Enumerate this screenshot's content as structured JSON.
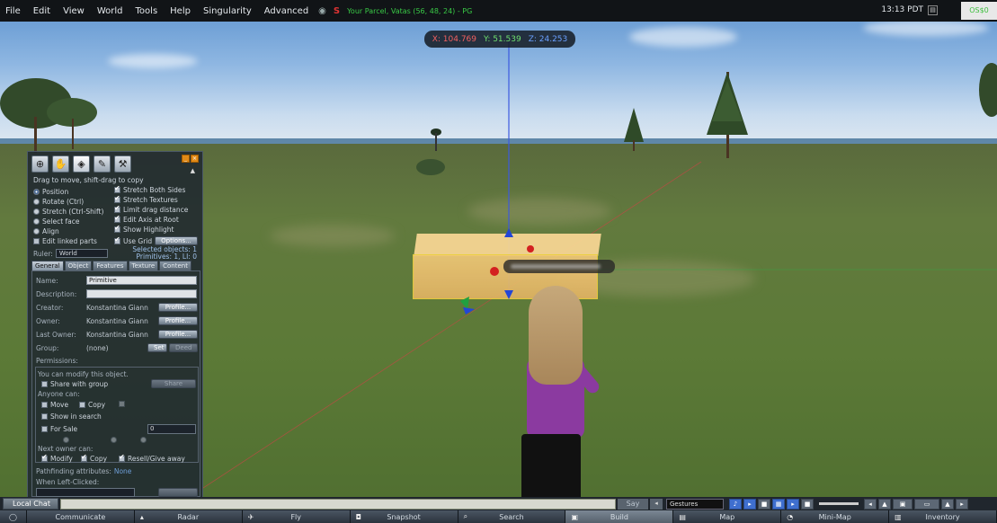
{
  "menubar": {
    "items": [
      "File",
      "Edit",
      "View",
      "World",
      "Tools",
      "Help",
      "Singularity",
      "Advanced"
    ],
    "parcel_text": "Your Parcel, Vatas (56, 48, 24) - PG",
    "time": "13:13 PDT",
    "balance": "OS$0"
  },
  "coords": {
    "x": "X: 104.769",
    "y": "Y: 51.539",
    "z": "Z: 24.253"
  },
  "build": {
    "hint": "Drag to move, shift-drag to copy",
    "modes": [
      "Position",
      "Rotate (Ctrl)",
      "Stretch (Ctrl-Shift)",
      "Select face",
      "Align"
    ],
    "selected_mode": "Position",
    "edit_linked": "Edit linked parts",
    "options_right": [
      "Stretch Both Sides",
      "Stretch Textures",
      "Limit drag distance",
      "Edit Axis at Root",
      "Show Highlight",
      "Use Grid"
    ],
    "options_button": "Options...",
    "ruler_label": "Ruler:",
    "ruler_value": "World",
    "selected_objects": "Selected objects: 1",
    "primitives": "Primitives: 1, LI: 0",
    "tabs": [
      "General",
      "Object",
      "Features",
      "Texture",
      "Content"
    ],
    "active_tab": "General",
    "general": {
      "name_label": "Name:",
      "name_value": "Primitive",
      "description_label": "Description:",
      "description_value": "",
      "creator_label": "Creator:",
      "creator_value": "Konstantina Giann",
      "owner_label": "Owner:",
      "owner_value": "Konstantina Giann",
      "last_owner_label": "Last Owner:",
      "last_owner_value": "Konstantina Giann",
      "profile_button": "Profile...",
      "group_label": "Group:",
      "group_value": "(none)",
      "set_button": "Set",
      "deed_button": "Deed",
      "permissions_label": "Permissions:",
      "can_modify": "You can modify this object.",
      "share_with_group": "Share with group",
      "share_button": "Share",
      "anyone_can": "Anyone can:",
      "move": "Move",
      "copy": "Copy",
      "show_in_search": "Show in search",
      "for_sale": "For Sale",
      "sale_price": "0",
      "next_owner_can": "Next owner can:",
      "modify": "Modify",
      "copy2": "Copy",
      "resell": "Resell/Give away",
      "pathfinding": "Pathfinding attributes:",
      "pathfinding_value": "None",
      "when_left_clicked": "When Left-Clicked:"
    }
  },
  "chat": {
    "local_chat": "Local Chat",
    "say": "Say",
    "gestures": "Gestures"
  },
  "toolbar": [
    "Communicate",
    "Radar",
    "Fly",
    "Snapshot",
    "Search",
    "Build",
    "Map",
    "Mini-Map",
    "Inventory"
  ],
  "active_toolbar": "Build",
  "colors": {
    "menubar_bg": "#111417",
    "panel_bg": "#1e2630",
    "accent": "#e08a18"
  }
}
